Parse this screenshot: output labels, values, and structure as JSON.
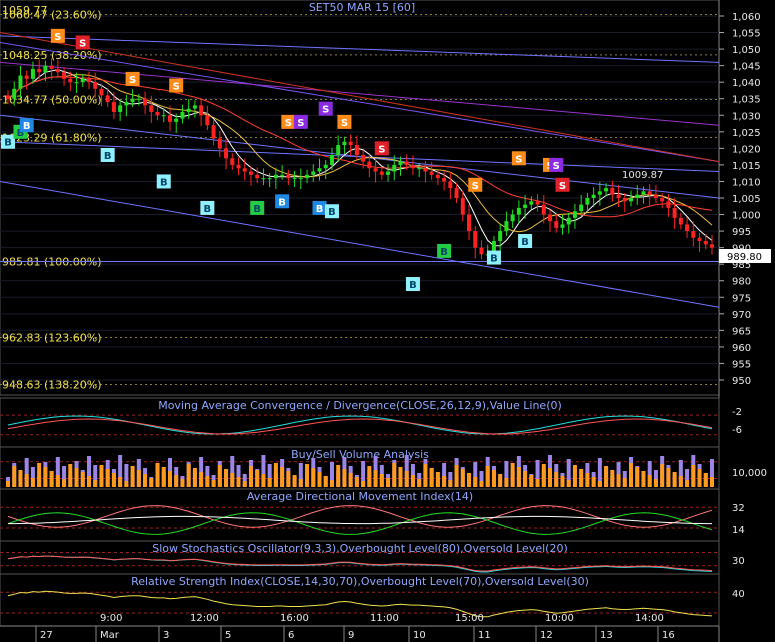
{
  "chart_data": {
    "type": "candlestick",
    "title": "SET50 MAR 15 [60]",
    "last_price_label": "989.80",
    "ylim": [
      945,
      1062
    ],
    "y_ticks": [
      950,
      955,
      960,
      965,
      970,
      975,
      980,
      985,
      990,
      995,
      1000,
      1005,
      1010,
      1015,
      1020,
      1025,
      1030,
      1035,
      1040,
      1045,
      1050,
      1055,
      1060
    ],
    "y_tick_labels": [
      "950",
      "955",
      "960",
      "965",
      "970",
      "975",
      "980",
      "985",
      "990",
      "995",
      "1,000",
      "1,005",
      "1,010",
      "1,015",
      "1,020",
      "1,025",
      "1,030",
      "1,035",
      "1,040",
      "1,045",
      "1,050",
      "1,055",
      "1,060"
    ],
    "fib_levels": [
      {
        "label": "1060.47 (23.60%)",
        "value": 1060.47
      },
      {
        "label": "1048.25 (38.20%)",
        "value": 1048.25
      },
      {
        "label": "1034.77 (50.00%)",
        "value": 1034.77
      },
      {
        "label": "1023.29 (61.80%)",
        "value": 1023.29
      },
      {
        "label": "985.81 (100.00%)",
        "value": 985.81
      },
      {
        "label": "962.83 (123.60%)",
        "value": 962.83
      },
      {
        "label": "948.63 (138.20%)",
        "value": 948.63
      }
    ],
    "top_left_label": "1059.77",
    "annotation": {
      "label": "1009.87",
      "value": 1009.87
    },
    "closes": [
      1035,
      1038,
      1042,
      1041,
      1044,
      1043,
      1045,
      1044,
      1043,
      1041,
      1040,
      1040,
      1041,
      1040,
      1038,
      1036,
      1034,
      1031,
      1033,
      1034,
      1035,
      1035,
      1033,
      1031,
      1030,
      1030,
      1028,
      1029,
      1031,
      1032,
      1033,
      1030,
      1027,
      1023,
      1020,
      1017,
      1015,
      1014,
      1013,
      1012,
      1011,
      1011,
      1011,
      1012,
      1012,
      1011,
      1011,
      1011,
      1012,
      1013,
      1014,
      1015,
      1018,
      1021,
      1022,
      1021,
      1018,
      1016,
      1014,
      1013,
      1012,
      1013,
      1015,
      1016,
      1015,
      1014,
      1014,
      1013,
      1012,
      1011,
      1010,
      1008,
      1005,
      1000,
      995,
      990,
      988,
      988,
      992,
      995,
      998,
      1000,
      1002,
      1003,
      1004,
      1003,
      1000,
      998,
      996,
      997,
      999,
      1001,
      1003,
      1005,
      1006,
      1007,
      1008,
      1006,
      1005,
      1004,
      1005,
      1006,
      1007,
      1006,
      1005,
      1004,
      1002,
      999,
      997,
      995,
      993,
      992,
      991,
      990
    ],
    "x_tick_labels": [
      "27",
      "Mar",
      "3",
      "5",
      "6",
      "9",
      "10",
      "11",
      "12",
      "13",
      "16"
    ],
    "time_labels": [
      "9:00",
      "12:00",
      "16:00",
      "11:00",
      "15:00",
      "10:00",
      "14:00"
    ],
    "signals": [
      {
        "t": "B",
        "i": 0,
        "v": 1022,
        "c": "#8ff0ff"
      },
      {
        "t": "B",
        "i": 2,
        "v": 1025,
        "c": "#22cc44"
      },
      {
        "t": "B",
        "i": 3,
        "v": 1027,
        "c": "#1e88e5"
      },
      {
        "t": "S",
        "i": 8,
        "v": 1054,
        "c": "#ff8c1a"
      },
      {
        "t": "S",
        "i": 12,
        "v": 1052,
        "c": "#e0202a"
      },
      {
        "t": "B",
        "i": 16,
        "v": 1018,
        "c": "#8ff0ff"
      },
      {
        "t": "S",
        "i": 20,
        "v": 1041,
        "c": "#ff8c1a"
      },
      {
        "t": "B",
        "i": 25,
        "v": 1010,
        "c": "#8ff0ff"
      },
      {
        "t": "S",
        "i": 27,
        "v": 1039,
        "c": "#ff8c1a"
      },
      {
        "t": "B",
        "i": 32,
        "v": 1002,
        "c": "#8ff0ff"
      },
      {
        "t": "B",
        "i": 40,
        "v": 1002,
        "c": "#22cc44"
      },
      {
        "t": "B",
        "i": 44,
        "v": 1004,
        "c": "#1e88e5"
      },
      {
        "t": "S",
        "i": 45,
        "v": 1028,
        "c": "#ff8c1a"
      },
      {
        "t": "S",
        "i": 47,
        "v": 1028,
        "c": "#8a2be2"
      },
      {
        "t": "S",
        "i": 51,
        "v": 1032,
        "c": "#8a2be2"
      },
      {
        "t": "B",
        "i": 50,
        "v": 1002,
        "c": "#1e88e5"
      },
      {
        "t": "B",
        "i": 52,
        "v": 1001,
        "c": "#8ff0ff"
      },
      {
        "t": "S",
        "i": 54,
        "v": 1028,
        "c": "#ff8c1a"
      },
      {
        "t": "S",
        "i": 60,
        "v": 1020,
        "c": "#e0202a"
      },
      {
        "t": "B",
        "i": 65,
        "v": 979,
        "c": "#8ff0ff"
      },
      {
        "t": "B",
        "i": 70,
        "v": 989,
        "c": "#22cc44"
      },
      {
        "t": "S",
        "i": 75,
        "v": 1009,
        "c": "#ff8c1a"
      },
      {
        "t": "B",
        "i": 78,
        "v": 987,
        "c": "#8ff0ff"
      },
      {
        "t": "S",
        "i": 82,
        "v": 1017,
        "c": "#ff8c1a"
      },
      {
        "t": "B",
        "i": 83,
        "v": 992,
        "c": "#8ff0ff"
      },
      {
        "t": "S",
        "i": 87,
        "v": 1015,
        "c": "#ff8c1a"
      },
      {
        "t": "S",
        "i": 88,
        "v": 1015,
        "c": "#8a2be2"
      },
      {
        "t": "S",
        "i": 89,
        "v": 1009,
        "c": "#e0202a"
      }
    ],
    "panels": [
      {
        "title": "Moving Average Convergence / Divergence(CLOSE,26,12,9),Value Line(0)",
        "y_tick_labels": [
          "-2",
          "-6"
        ]
      },
      {
        "title": "Buy/Sell Volume Analysis",
        "y_tick_labels": [
          "10,000"
        ]
      },
      {
        "title": "Average Directional Movement Index(14)",
        "y_tick_labels": [
          "32",
          "14"
        ]
      },
      {
        "title": "Slow Stochastics Oscillator(9,3,3),Overbought Level(80),Oversold Level(20)",
        "y_tick_labels": [
          "30"
        ]
      },
      {
        "title": "Relative Strength Index(CLOSE,14,30,70),Overbought Level(70),Oversold Level(30)",
        "y_tick_labels": [
          "40"
        ]
      }
    ],
    "colors": {
      "up": "#22dd22",
      "down": "#ff2222",
      "axis": "#e8e8e8",
      "fib": "#f0e050",
      "title": "#8fa8ff"
    }
  }
}
